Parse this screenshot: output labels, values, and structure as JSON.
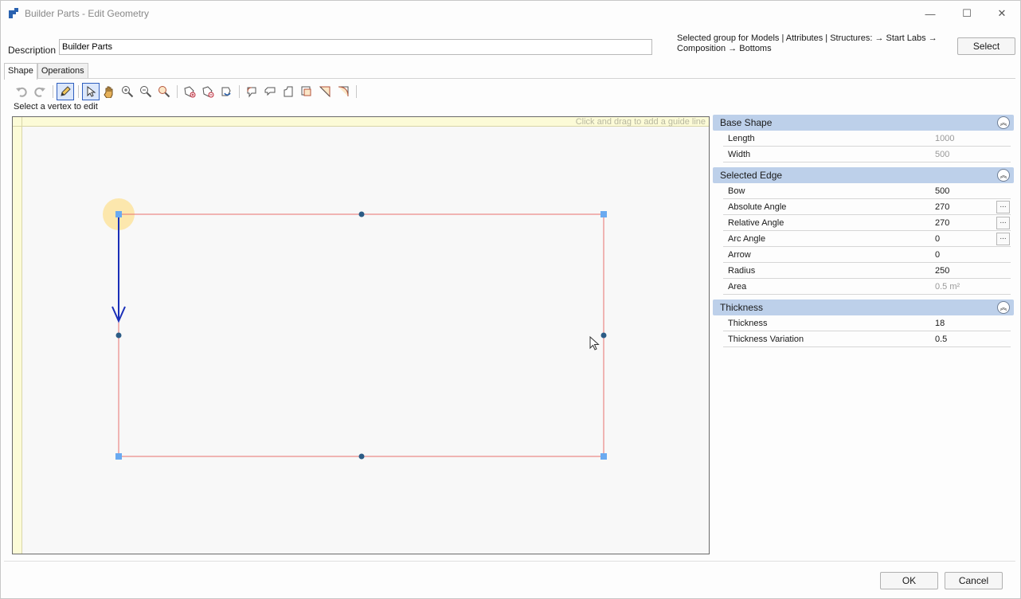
{
  "window": {
    "title": "Builder Parts - Edit Geometry",
    "minimize_glyph": "—",
    "maximize_glyph": "☐",
    "close_glyph": "✕"
  },
  "description": {
    "label": "Description",
    "value": "Builder Parts"
  },
  "selected_group": {
    "line1": "Selected group for Models | Attributes | Structures: → Start Labs →",
    "line2": "Composition → Bottoms",
    "select_label": "Select"
  },
  "tabs": [
    {
      "label": "Shape",
      "active": true
    },
    {
      "label": "Operations",
      "active": false
    }
  ],
  "toolbar": {
    "hint": "Select a vertex to edit"
  },
  "canvas": {
    "ruler_hint": "Click and drag to add a guide line"
  },
  "properties": {
    "base_shape": {
      "title": "Base Shape",
      "rows": [
        {
          "key": "Length",
          "value": "1000"
        },
        {
          "key": "Width",
          "value": "500"
        }
      ]
    },
    "selected_edge": {
      "title": "Selected Edge",
      "rows": [
        {
          "key": "Bow",
          "value": "500"
        },
        {
          "key": "Absolute Angle",
          "value": "270"
        },
        {
          "key": "Relative Angle",
          "value": "270"
        },
        {
          "key": "Arc Angle",
          "value": "0"
        },
        {
          "key": "Arrow",
          "value": "0"
        },
        {
          "key": "Radius",
          "value": "250"
        },
        {
          "key": "Area",
          "value": "0.5 m²"
        }
      ]
    },
    "thickness": {
      "title": "Thickness",
      "rows": [
        {
          "key": "Thickness",
          "value": "18"
        },
        {
          "key": "Thickness Variation",
          "value": "0.5"
        }
      ]
    },
    "more_glyph": "...",
    "collapse_glyph": "︽"
  },
  "buttons": {
    "ok": "OK",
    "cancel": "Cancel"
  },
  "colors": {
    "shape_edge": "#e8716e",
    "selected_edge_arrow": "#1a2fb8",
    "vertex_handle": "#6aaaf0",
    "midpoint_handle": "#2c5c86",
    "selected_vertex_glow": "#fde4a0",
    "section_header": "#bdd0ea",
    "ruler": "#fcfbd7"
  }
}
